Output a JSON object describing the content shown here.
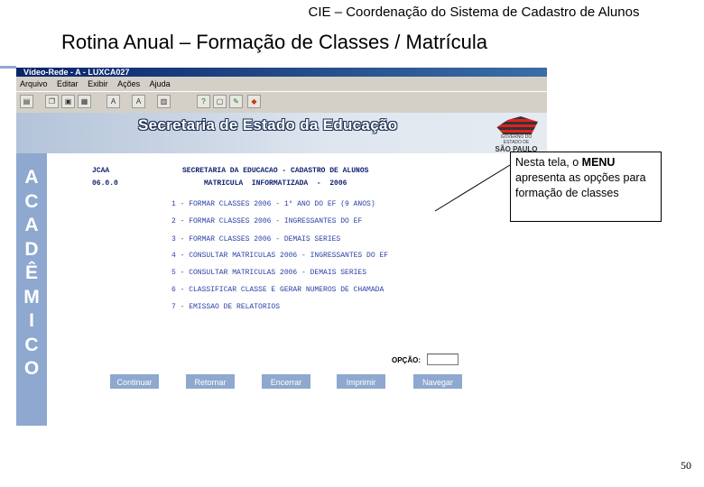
{
  "slide": {
    "header": "CIE – Coordenação do Sistema de Cadastro de Alunos",
    "title": "Rotina Anual – Formação de Classes / Matrícula",
    "page_number": "50"
  },
  "window": {
    "title": "Vídeo-Rede - A - LUXCA027",
    "menu": [
      "Arquivo",
      "Editar",
      "Exibir",
      "Ações",
      "Ajuda"
    ],
    "banner": "Secretaria de Estado da Educação",
    "gov_logo": {
      "line1": "GOVERNO DO ESTADO DE",
      "line2": "SÃO PAULO"
    }
  },
  "sidebar": {
    "letters": [
      "A",
      "C",
      "A",
      "D",
      "Ê",
      "M",
      "I",
      "C",
      "O"
    ]
  },
  "screen": {
    "code": "JCAA",
    "version": "06.0.0",
    "header1": "SECRETARIA DA EDUCACAO - CADASTRO DE ALUNOS",
    "header2": "MATRICULA  INFORMATIZADA  -  2006",
    "options": [
      "1 - FORMAR CLASSES 2006 - 1° ANO DO EF (9 ANOS)",
      "2 - FORMAR CLASSES 2006 - INGRESSANTES DO EF",
      "3 - FORMAR CLASSES 2006 - DEMAIS SERIES",
      "4 - CONSULTAR MATRICULAS 2006 - INGRESSANTES DO EF",
      "5 - CONSULTAR MATRICULAS 2006 - DEMAIS SERIES",
      "6 - CLASSIFICAR CLASSE E GERAR NUMEROS DE CHAMADA",
      "7 - EMISSAO DE RELATORIOS"
    ],
    "opcao_label": "OPÇÃO:",
    "opcao_value": "",
    "buttons": [
      "Continuar",
      "Retornar",
      "Encerrar",
      "Imprimir",
      "Navegar"
    ]
  },
  "callout": {
    "text_before": "Nesta tela, o ",
    "text_bold": "MENU",
    "text_after": " apresenta as opções para formação de classes"
  },
  "colors": {
    "sidebar": "#8ea8cf",
    "mono_text": "#1a2f8a",
    "button": "#8ea8cf"
  }
}
